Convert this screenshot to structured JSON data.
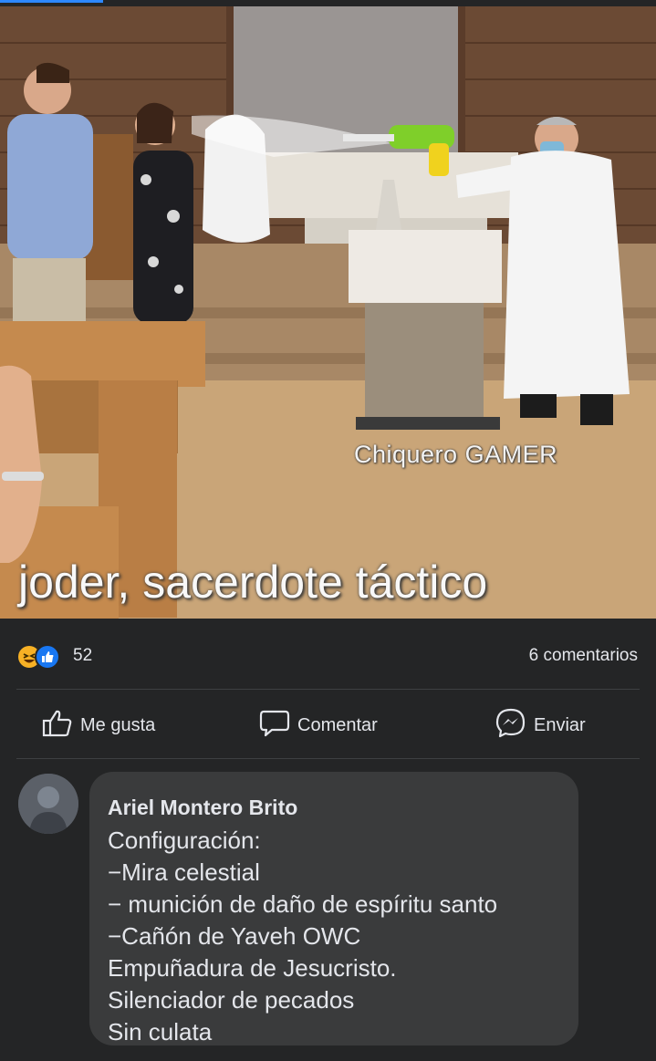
{
  "post": {
    "watermark": "Chiquero GAMER",
    "caption": "joder, sacerdote táctico"
  },
  "stats": {
    "reaction_icons": [
      "haha-icon",
      "like-icon"
    ],
    "reaction_count": "52",
    "comments_label": "6 comentarios"
  },
  "actions": {
    "like_label": "Me gusta",
    "comment_label": "Comentar",
    "send_label": "Enviar"
  },
  "comment": {
    "author": "Ariel Montero Brito",
    "lines": [
      "Configuración:",
      "−Mira celestial",
      "− munición de daño de espíritu santo",
      "−Cañón de Yaveh OWC",
      "Empuñadura de Jesucristo.",
      "Silenciador de pecados",
      "Sin culata"
    ]
  },
  "colors": {
    "background": "#18191a",
    "card": "#242526",
    "bubble": "#3a3b3c",
    "text": "#e4e6eb",
    "accent": "#1877f2"
  }
}
